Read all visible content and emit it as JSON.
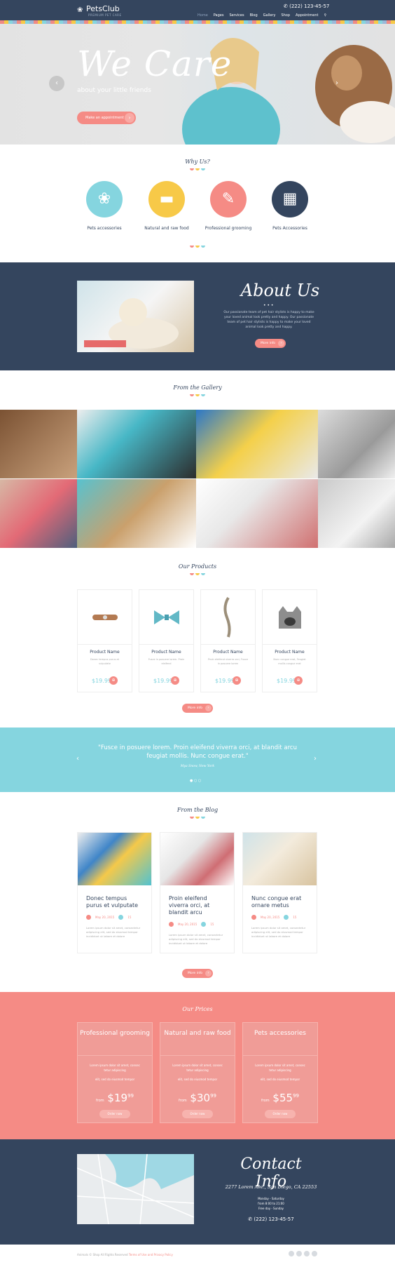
{
  "header": {
    "logo": "PetsClub",
    "tagline": "PREMIUM PET CARE",
    "phone": "(222) 123-45-57",
    "nav": [
      "Home",
      "Pages",
      "Services",
      "Blog",
      "Gallery",
      "Shop",
      "Appointment"
    ]
  },
  "hero": {
    "title": "We Care",
    "subtitle": "about your little friends",
    "button": "Make an appointment",
    "prev": "‹",
    "next": "›"
  },
  "why": {
    "title": "Why Us?",
    "items": [
      {
        "label": "Pets accessories",
        "color": "#85d5df",
        "icon": "paw-icon"
      },
      {
        "label": "Natural and raw food",
        "color": "#f7c948",
        "icon": "food-icon"
      },
      {
        "label": "Professional grooming",
        "color": "#f58b85",
        "icon": "brush-icon"
      },
      {
        "label": "Pets Accessories",
        "color": "#34455e",
        "icon": "carrier-icon"
      }
    ]
  },
  "about": {
    "title": "About Us",
    "text": "Our passionate team of pet hair stylists is happy to make your loved animal look pretty and happy. Our passionate team of pet hair stylists is happy to make your loved animal look pretty and happy.",
    "button": "More info"
  },
  "gallery": {
    "title": "From the Gallery"
  },
  "products": {
    "title": "Our Products",
    "items": [
      {
        "name": "Product Name",
        "desc": "Donec tempus purus et vulputate",
        "price": "$19.99"
      },
      {
        "name": "Product Name",
        "desc": "Fusce in posuere lorem. Proin eleifend",
        "price": "$19.99"
      },
      {
        "name": "Product Name",
        "desc": "Proin eleifend viverra orci, Fusce in posuere lorem",
        "price": "$19.99"
      },
      {
        "name": "Product Name",
        "desc": "Nunc congue erat, Feugiat mollis congue erat",
        "price": "$19.99"
      }
    ],
    "button": "More info"
  },
  "quote": {
    "text": "\"Fusce in posuere lorem. Proin eleifend viverra orci, at blandit arcu feugiat mollis. Nunc congue erat.\"",
    "author": "Mya Snow, New York"
  },
  "blog": {
    "title": "From the Blog",
    "posts": [
      {
        "title": "Donec tempus purus et vulputate",
        "date": "May 20, 2015",
        "comments": "15",
        "excerpt": "Lorem ipsum dolor sit amet, consectetur adipiscing elit, sed do eiusmod tempor incididunt ut labore et dolore"
      },
      {
        "title": "Proin eleifend viverra orci, at blandit arcu",
        "date": "May 20, 2015",
        "comments": "15",
        "excerpt": "Lorem ipsum dolor sit amet, consectetur adipiscing elit, sed do eiusmod tempor incididunt ut labore et dolore"
      },
      {
        "title": "Nunc congue erat ornare metus",
        "date": "May 20, 2015",
        "comments": "15",
        "excerpt": "Lorem ipsum dolor sit amet, consectetur adipiscing elit, sed do eiusmod tempor incididunt ut labore et dolore"
      }
    ],
    "button": "More info"
  },
  "prices": {
    "title": "Our Prices",
    "plans": [
      {
        "name": "Professional grooming",
        "text1": "Lorem ipsum dolor sit amet, consec tetur adipiscing",
        "text2": "elit, sed do eiusmod tempor",
        "from": "from",
        "price": "$19",
        "cents": "99",
        "button": "Order now"
      },
      {
        "name": "Natural and raw food",
        "text1": "Lorem ipsum dolor sit amet, consec tetur adipiscing",
        "text2": "elit, sed do eiusmod tempor",
        "from": "from",
        "price": "$30",
        "cents": "99",
        "button": "Order now"
      },
      {
        "name": "Pets accessories",
        "text1": "Lorem ipsum dolor sit amet, consec tetur adipiscing",
        "text2": "elit, sed do eiusmod tempor",
        "from": "from",
        "price": "$55",
        "cents": "99",
        "button": "Order now"
      }
    ]
  },
  "contact": {
    "title": "Contact Info",
    "address": "2277 Lorem Ave., San Diego, CA 22553",
    "hours1": "Monday - Saturday",
    "hours2": "from 8:00 to 21:00",
    "hours3": "Free day - Sunday",
    "phone": "(222) 123-45-57"
  },
  "footer": {
    "copyright": "Animals © Shop All Rights Reserved",
    "links": "Terms of Use and Privacy Policy"
  },
  "colors": {
    "navy": "#34455e",
    "coral": "#f58b85",
    "aqua": "#85d5df",
    "yellow": "#f7c948"
  }
}
